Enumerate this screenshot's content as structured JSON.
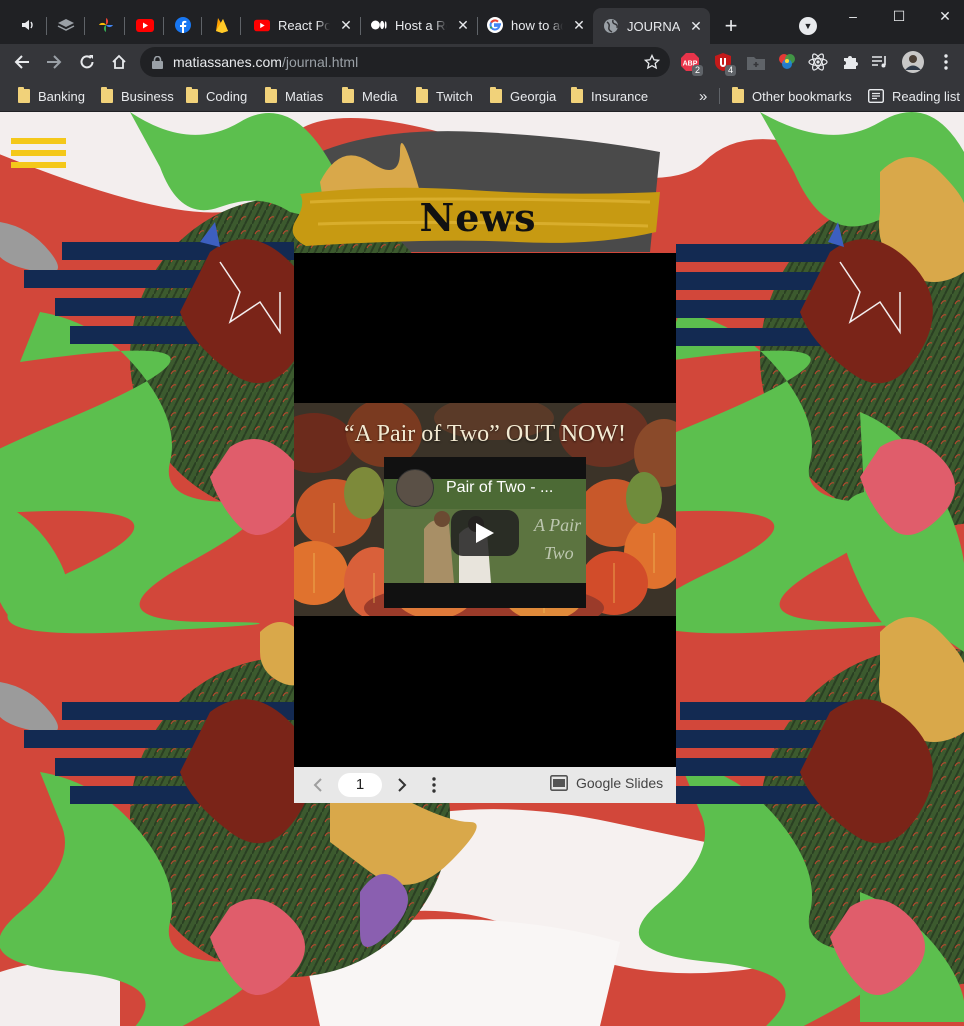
{
  "browser": {
    "tabs": [
      {
        "kind": "mini",
        "icon": "speaker-icon"
      },
      {
        "kind": "mini",
        "icon": "layers-icon"
      },
      {
        "kind": "mini",
        "icon": "pinwheel-icon"
      },
      {
        "kind": "mini",
        "icon": "youtube-icon"
      },
      {
        "kind": "mini",
        "icon": "facebook-icon"
      },
      {
        "kind": "mini",
        "icon": "firebase-icon"
      },
      {
        "kind": "full",
        "icon": "youtube-icon",
        "title": "React Port"
      },
      {
        "kind": "full",
        "icon": "medium-icon",
        "title": "Host a Re"
      },
      {
        "kind": "full",
        "icon": "google-icon",
        "title": "how to ac"
      },
      {
        "kind": "full",
        "icon": "globe-icon",
        "title": "JOURNAL",
        "active": true
      }
    ],
    "new_tab_label": "+",
    "window_controls": {
      "minimize": "–",
      "maximize": "☐",
      "close": "✕"
    },
    "address": {
      "domain": "matiassanes.com",
      "path": "/journal.html"
    },
    "extensions": [
      {
        "name": "adblock-icon",
        "badge": "2"
      },
      {
        "name": "ublock-icon",
        "badge": "4"
      },
      {
        "name": "folder-plus-icon",
        "badge": ""
      },
      {
        "name": "color-picker-icon",
        "badge": ""
      },
      {
        "name": "react-devtools-icon",
        "badge": ""
      },
      {
        "name": "puzzle-icon",
        "badge": ""
      },
      {
        "name": "media-control-icon",
        "badge": ""
      },
      {
        "name": "profile-avatar",
        "badge": ""
      }
    ],
    "bookmarks": [
      "Banking",
      "Business",
      "Coding",
      "Matias",
      "Media",
      "Twitch",
      "Georgia",
      "Insurance"
    ],
    "bookmarks_overflow": "»",
    "other_bookmarks": "Other bookmarks",
    "reading_list": "Reading list"
  },
  "page": {
    "heading": "News",
    "slide": {
      "heading": "“A Pair of Two” OUT NOW!",
      "video_title": "Pair of Two - ..."
    },
    "slides_controls": {
      "current_page": "1",
      "brand": "Google Slides"
    }
  },
  "colors": {
    "chrome_dark": "#202124",
    "chrome_toolbar": "#35363a",
    "page_red": "#d2473a",
    "leaf_green": "#5cbf4e",
    "menu_yellow": "#f4c81a",
    "banner_gold": "#c79a12",
    "stripe_navy": "#132a52"
  }
}
